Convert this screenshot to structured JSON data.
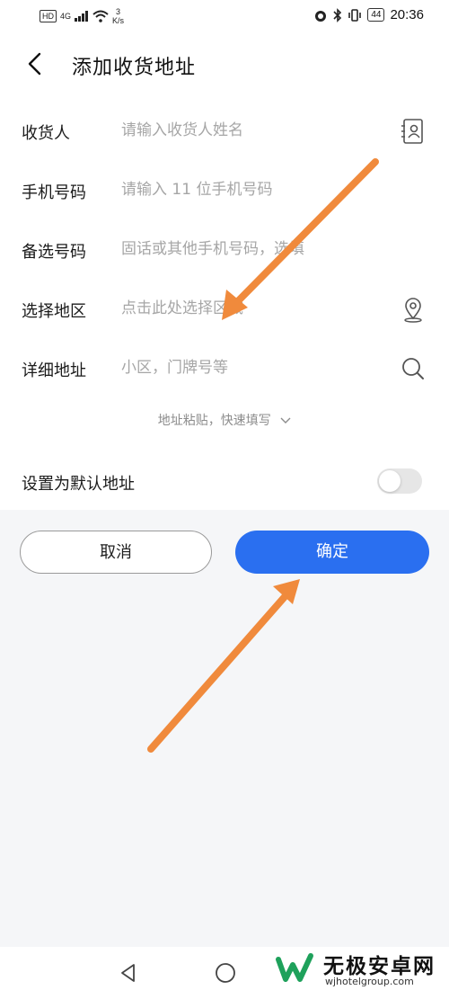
{
  "status_bar": {
    "hd": "HD",
    "network": "4G",
    "speed_value": "3",
    "speed_unit": "K/s",
    "battery": "44",
    "time": "20:36"
  },
  "header": {
    "title": "添加收货地址"
  },
  "form": {
    "rows": [
      {
        "label": "收货人",
        "placeholder": "请输入收货人姓名"
      },
      {
        "label": "手机号码",
        "placeholder": "请输入 11 位手机号码"
      },
      {
        "label": "备选号码",
        "placeholder": "固话或其他手机号码，选填"
      },
      {
        "label": "选择地区",
        "placeholder": "点击此处选择区域"
      },
      {
        "label": "详细地址",
        "placeholder": "小区，门牌号等"
      }
    ],
    "paste_hint": "地址粘贴，快速填写",
    "default_label": "设置为默认地址",
    "default_on": false
  },
  "buttons": {
    "cancel": "取消",
    "confirm": "确定"
  },
  "colors": {
    "primary": "#2a6ff0",
    "annotation_arrow": "#f08a3c"
  },
  "watermark": {
    "name": "无极安卓网",
    "url": "wjhotelgroup.com"
  }
}
